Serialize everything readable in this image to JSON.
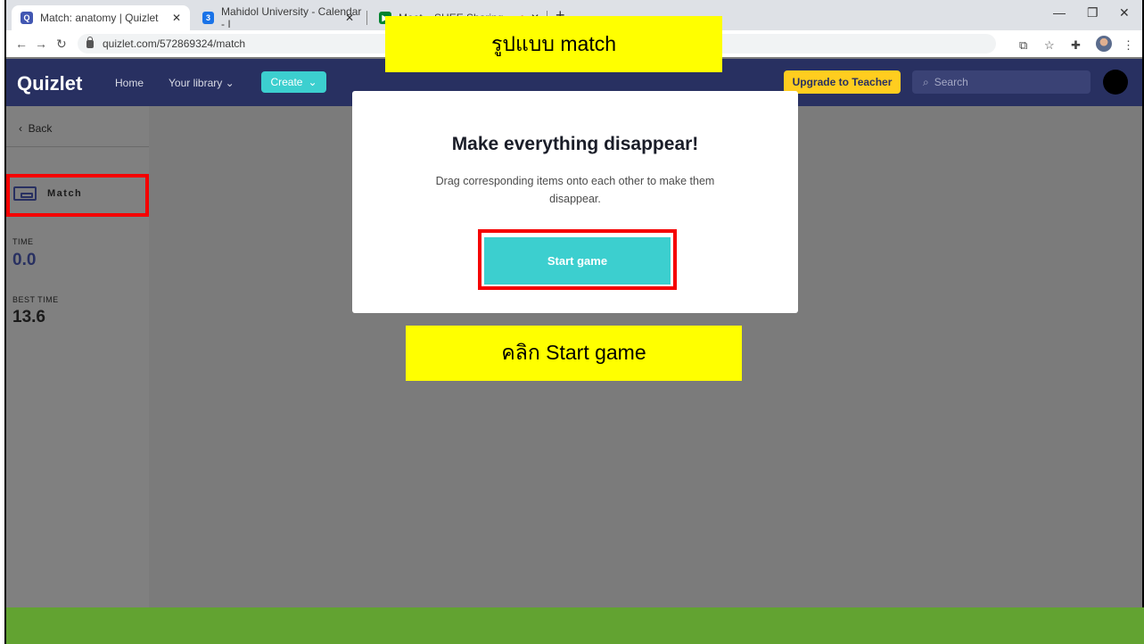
{
  "browser": {
    "tabs": [
      {
        "title": "Match: anatomy | Quizlet",
        "favicon": "quizlet-q-icon",
        "active": true
      },
      {
        "title": "Mahidol University - Calendar - I",
        "favicon": "google-calendar-icon"
      },
      {
        "title": "Meet – SHEE Sharing",
        "favicon": "google-meet-icon"
      }
    ],
    "url": "quizlet.com/572869324/match",
    "new_tab_label": "+"
  },
  "quizlet": {
    "logo": "Quizlet",
    "nav": {
      "home": "Home",
      "library": "Your library",
      "create": "Create"
    },
    "upgrade": "Upgrade to Teacher",
    "search_placeholder": "Search",
    "brand_color": "#283061",
    "accent_color": "#3ccfcf"
  },
  "sidebar": {
    "back": "Back",
    "mode": "Match",
    "time_label": "TIME",
    "time_value": "0.0",
    "best_time_label": "BEST TIME",
    "best_time_value": "13.6"
  },
  "modal": {
    "title": "Make everything disappear!",
    "description": "Drag corresponding items onto each other to make them disappear.",
    "start_button": "Start game"
  },
  "annotations": {
    "top_label": "รูปแบบ match",
    "bottom_label": "คลิก Start game",
    "highlight_color": "#f50000",
    "label_bg": "#ffff00"
  }
}
